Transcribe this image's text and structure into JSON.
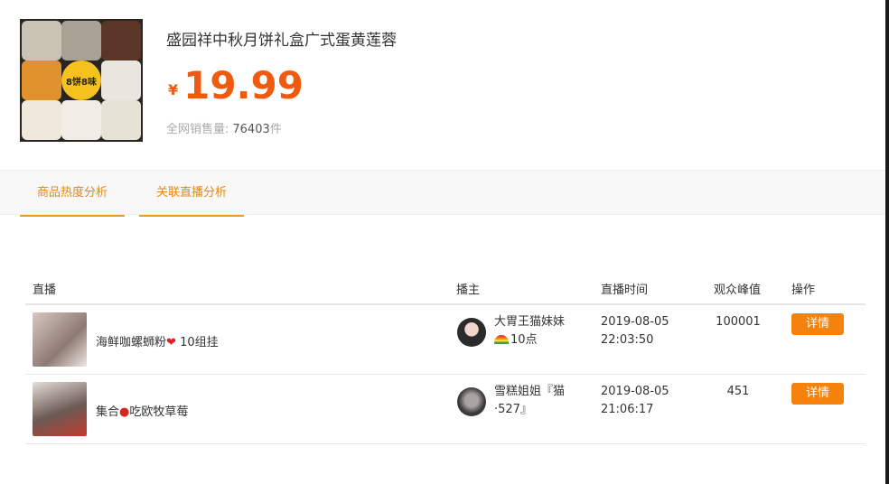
{
  "product": {
    "badge": "8饼8味",
    "title": "盛园祥中秋月饼礼盒广式蛋黄莲蓉",
    "currency": "¥",
    "price": "19.99",
    "sales_label": "全网销售量:",
    "sales_value": "76403",
    "sales_unit": "件"
  },
  "tabs": [
    {
      "label": "商品热度分析"
    },
    {
      "label": "关联直播分析"
    }
  ],
  "table": {
    "headers": [
      "直播",
      "播主",
      "直播时间",
      "观众峰值",
      "操作"
    ],
    "rows": [
      {
        "title": "海鲜咖螺蛳粉",
        "title_suffix": "10组挂",
        "host_line1": "大胃王猫妹妹",
        "host_line2": "10点",
        "date": "2019-08-05",
        "time": "22:03:50",
        "peak": "100001",
        "action": "详情"
      },
      {
        "title_prefix": "集合",
        "title": "吃欧牧草莓",
        "host_line1": "雪糕姐姐『猫",
        "host_line2": "·527』",
        "date": "2019-08-05",
        "time": "21:06:17",
        "peak": "451",
        "action": "详情"
      }
    ]
  },
  "colors": {
    "accent": "#f05a0e",
    "tab": "#e8870d",
    "button": "#f5820d"
  }
}
